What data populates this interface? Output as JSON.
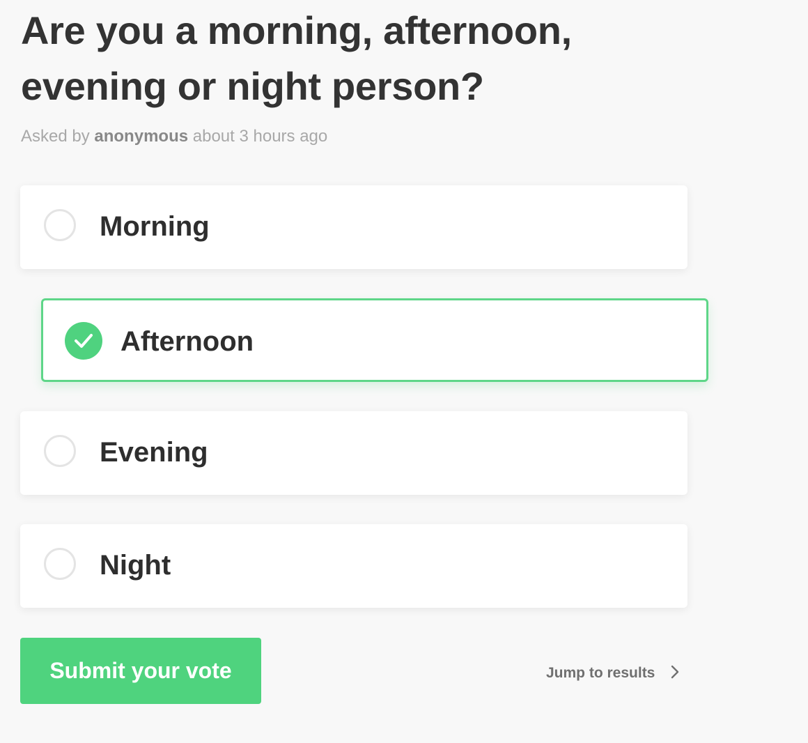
{
  "poll": {
    "question": "Are you a morning, afternoon, evening or night person?",
    "meta": {
      "prefix": "Asked by",
      "author": "anonymous",
      "time": "about 3 hours ago"
    },
    "options": [
      {
        "label": "Morning",
        "selected": false
      },
      {
        "label": "Afternoon",
        "selected": true
      },
      {
        "label": "Evening",
        "selected": false
      },
      {
        "label": "Night",
        "selected": false
      }
    ]
  },
  "actions": {
    "submit_label": "Submit your vote",
    "jump_label": "Jump to results",
    "jump_icon": "chevron-right-icon"
  },
  "colors": {
    "accent": "#4fd37e",
    "selected_border": "#5ed688",
    "title_text": "#333333",
    "meta_text": "#a8a8a8",
    "background": "#f8f8f8"
  }
}
